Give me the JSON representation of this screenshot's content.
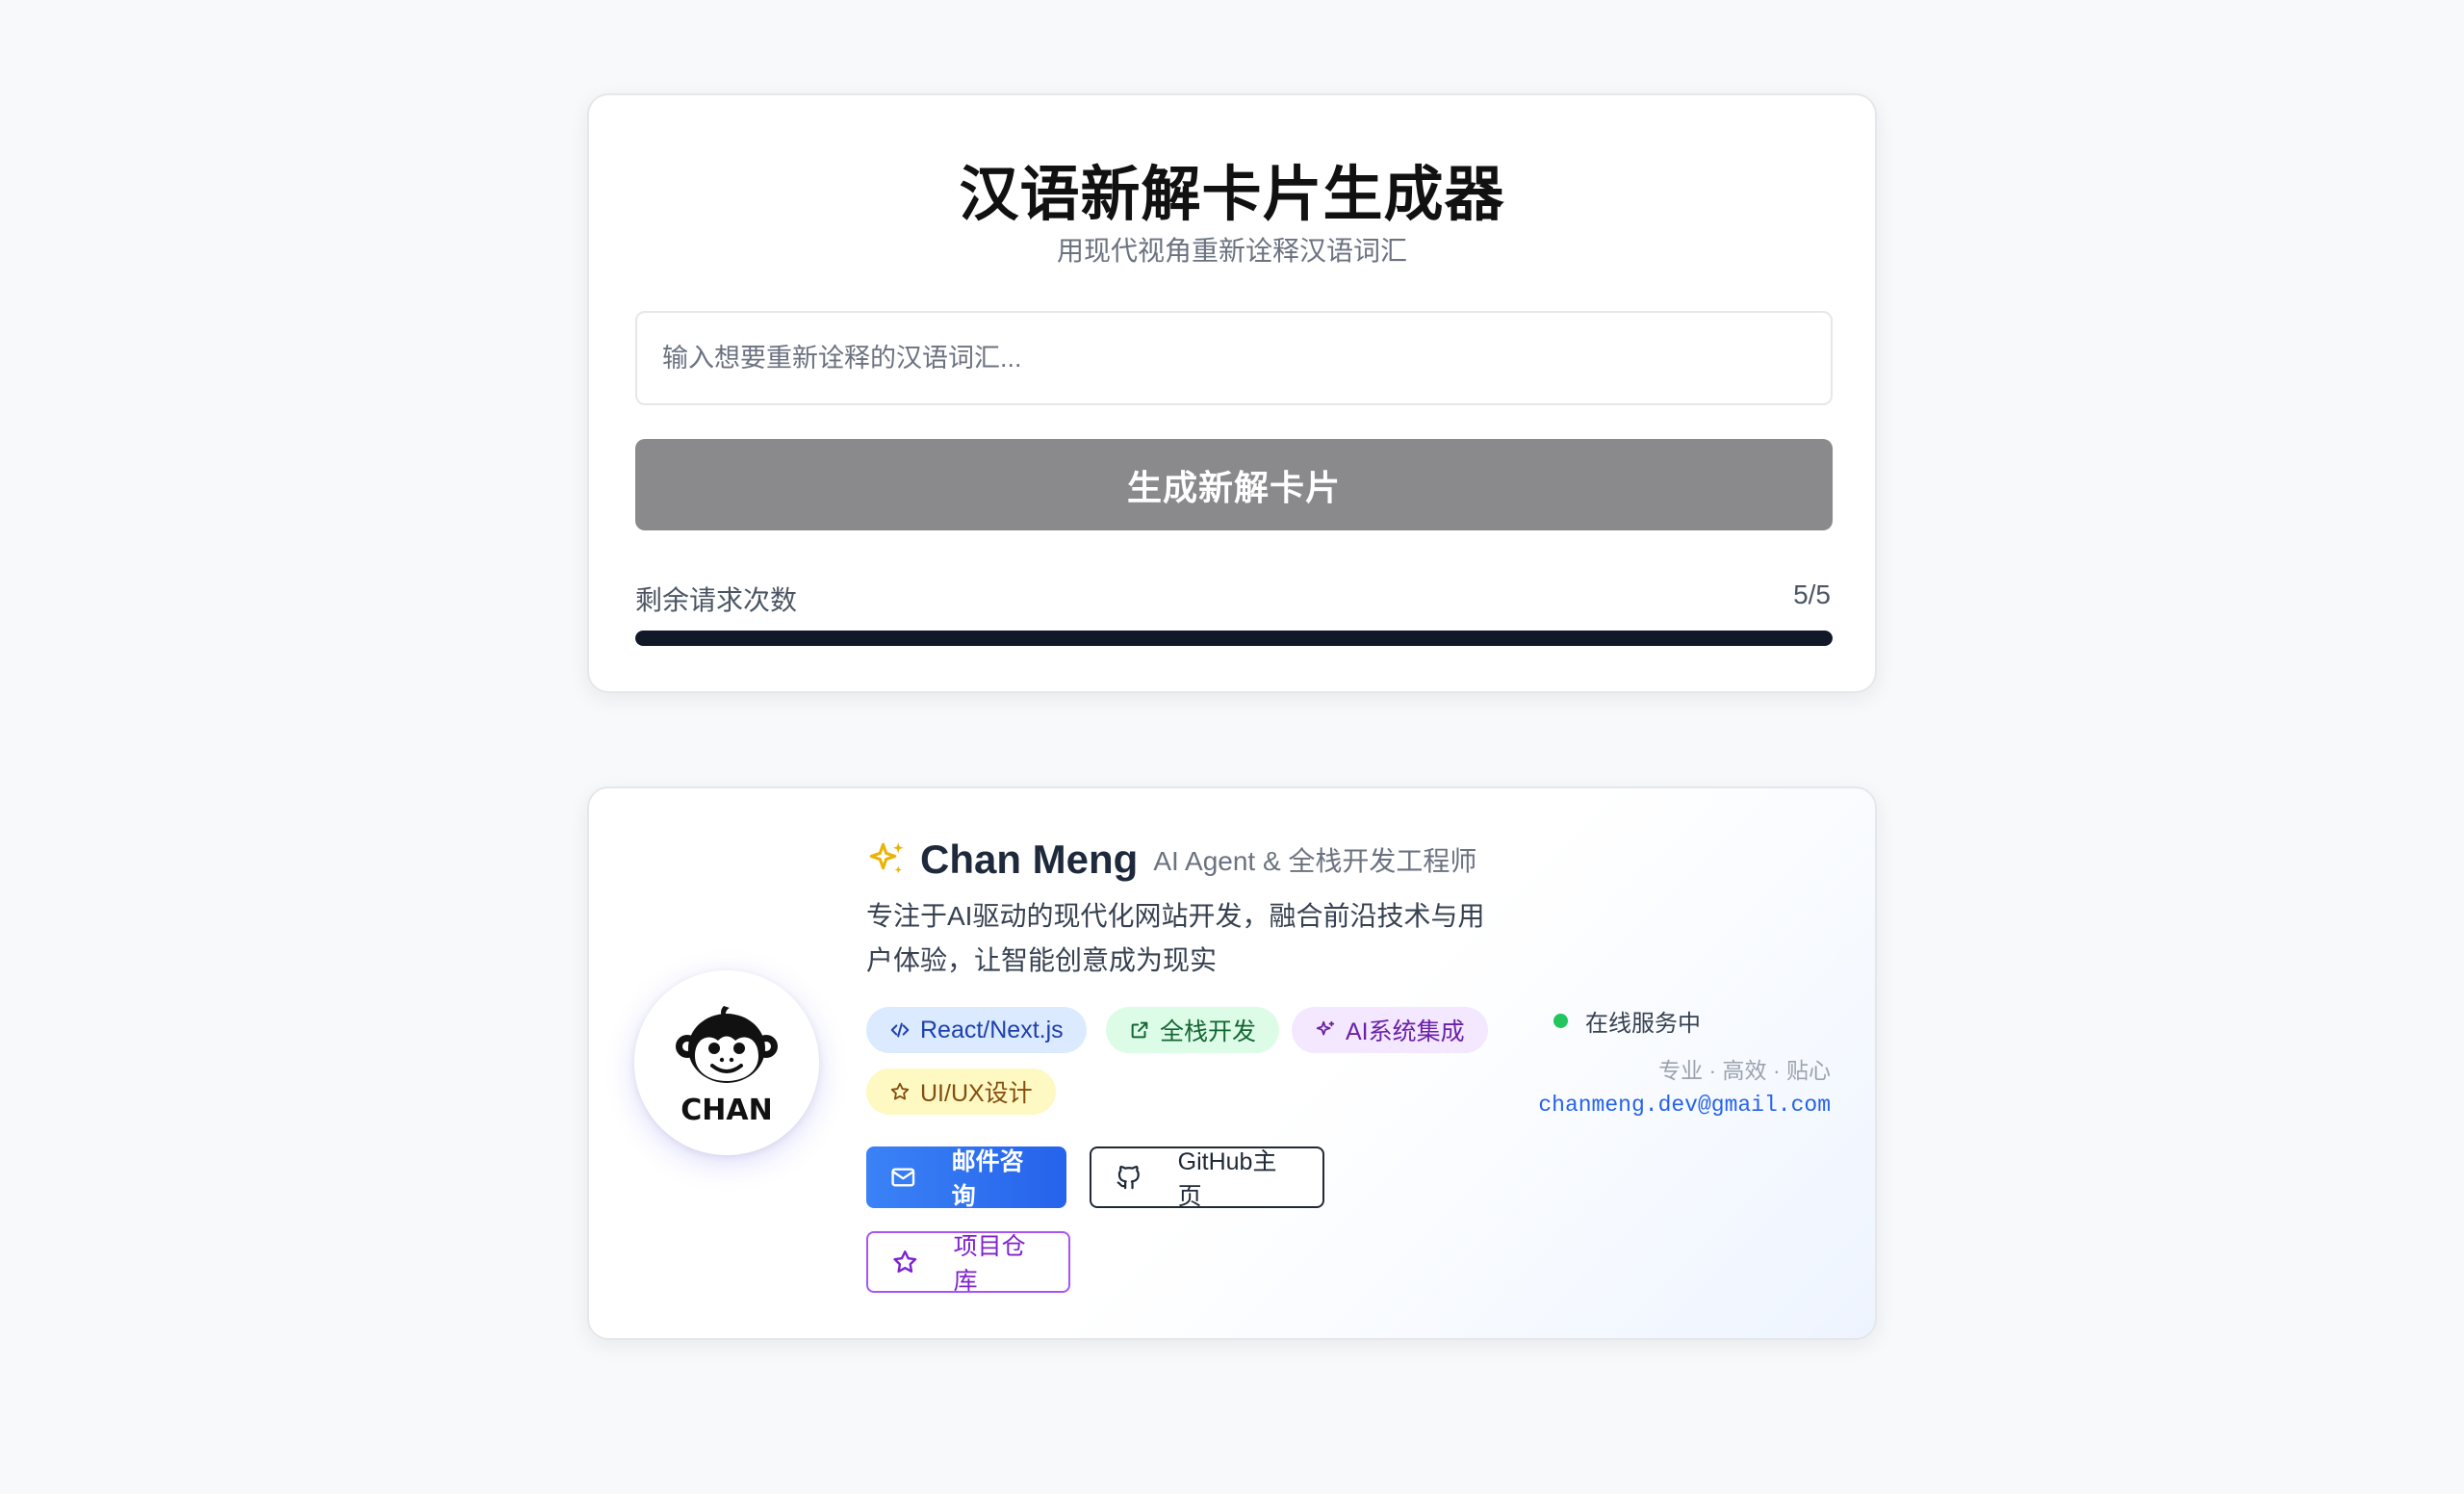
{
  "generator": {
    "title": "汉语新解卡片生成器",
    "subtitle": "用现代视角重新诠释汉语词汇",
    "input_placeholder": "输入想要重新诠释的汉语词汇...",
    "input_value": "",
    "generate_label": "生成新解卡片",
    "remaining_label": "剩余请求次数",
    "remaining_count": "5/5",
    "remaining_fraction": 1.0
  },
  "profile": {
    "avatar_text": "CHAN",
    "name": "Chan Meng",
    "role": "AI Agent & 全栈开发工程师",
    "description": "专注于AI驱动的现代化网站开发，融合前沿技术与用户体验，让智能创意成为现实",
    "tags": [
      {
        "label": "React/Next.js",
        "icon": "code-icon"
      },
      {
        "label": "全栈开发",
        "icon": "external-link-icon"
      },
      {
        "label": "AI系统集成",
        "icon": "sparkles-icon"
      },
      {
        "label": "UI/UX设计",
        "icon": "star-icon"
      }
    ],
    "buttons": {
      "email": "邮件咨询",
      "github": "GitHub主页",
      "repo": "项目仓库"
    },
    "status": "在线服务中",
    "motto": "专业 · 高效 · 贴心",
    "email": "chanmeng.dev@gmail.com"
  },
  "colors": {
    "accent_blue": "#2563eb",
    "status_green": "#22c55e",
    "button_gray": "#8a8a8c",
    "sparkle_gold": "#eab308"
  }
}
